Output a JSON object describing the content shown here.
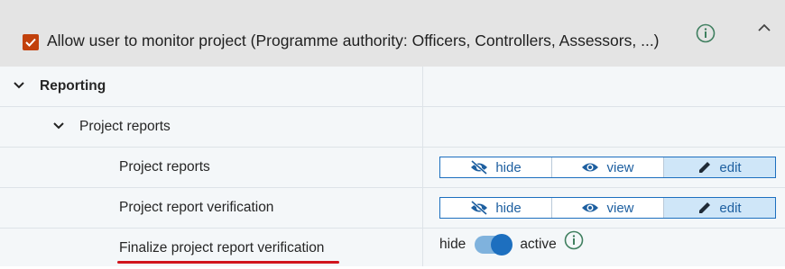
{
  "header": {
    "checkbox_checked": true,
    "label": "Allow user to monitor project (Programme authority: Officers, Controllers, Assessors, ...)",
    "info_icon": "info-circle-icon",
    "collapse_icon": "chevron-up-icon"
  },
  "rows": [
    {
      "label": "Reporting",
      "level": 0,
      "expandable": true,
      "expanded": true
    },
    {
      "label": "Project reports",
      "level": 1,
      "expandable": true,
      "expanded": true
    },
    {
      "label": "Project reports",
      "level": 2,
      "control": "segmented",
      "selected": "edit"
    },
    {
      "label": "Project report verification",
      "level": 2,
      "control": "segmented",
      "selected": "edit"
    },
    {
      "label": "Finalize project report verification",
      "level": 2,
      "control": "toggle",
      "toggle_on": true
    }
  ],
  "segmented_options": {
    "hide": "hide",
    "view": "view",
    "edit": "edit"
  },
  "toggle": {
    "off_label": "hide",
    "on_label": "active"
  },
  "colors": {
    "checkbox": "#c2410c",
    "accent": "#1d6fbf",
    "selected_bg": "#cfe6f8",
    "annotation_underline": "#d1141c"
  }
}
